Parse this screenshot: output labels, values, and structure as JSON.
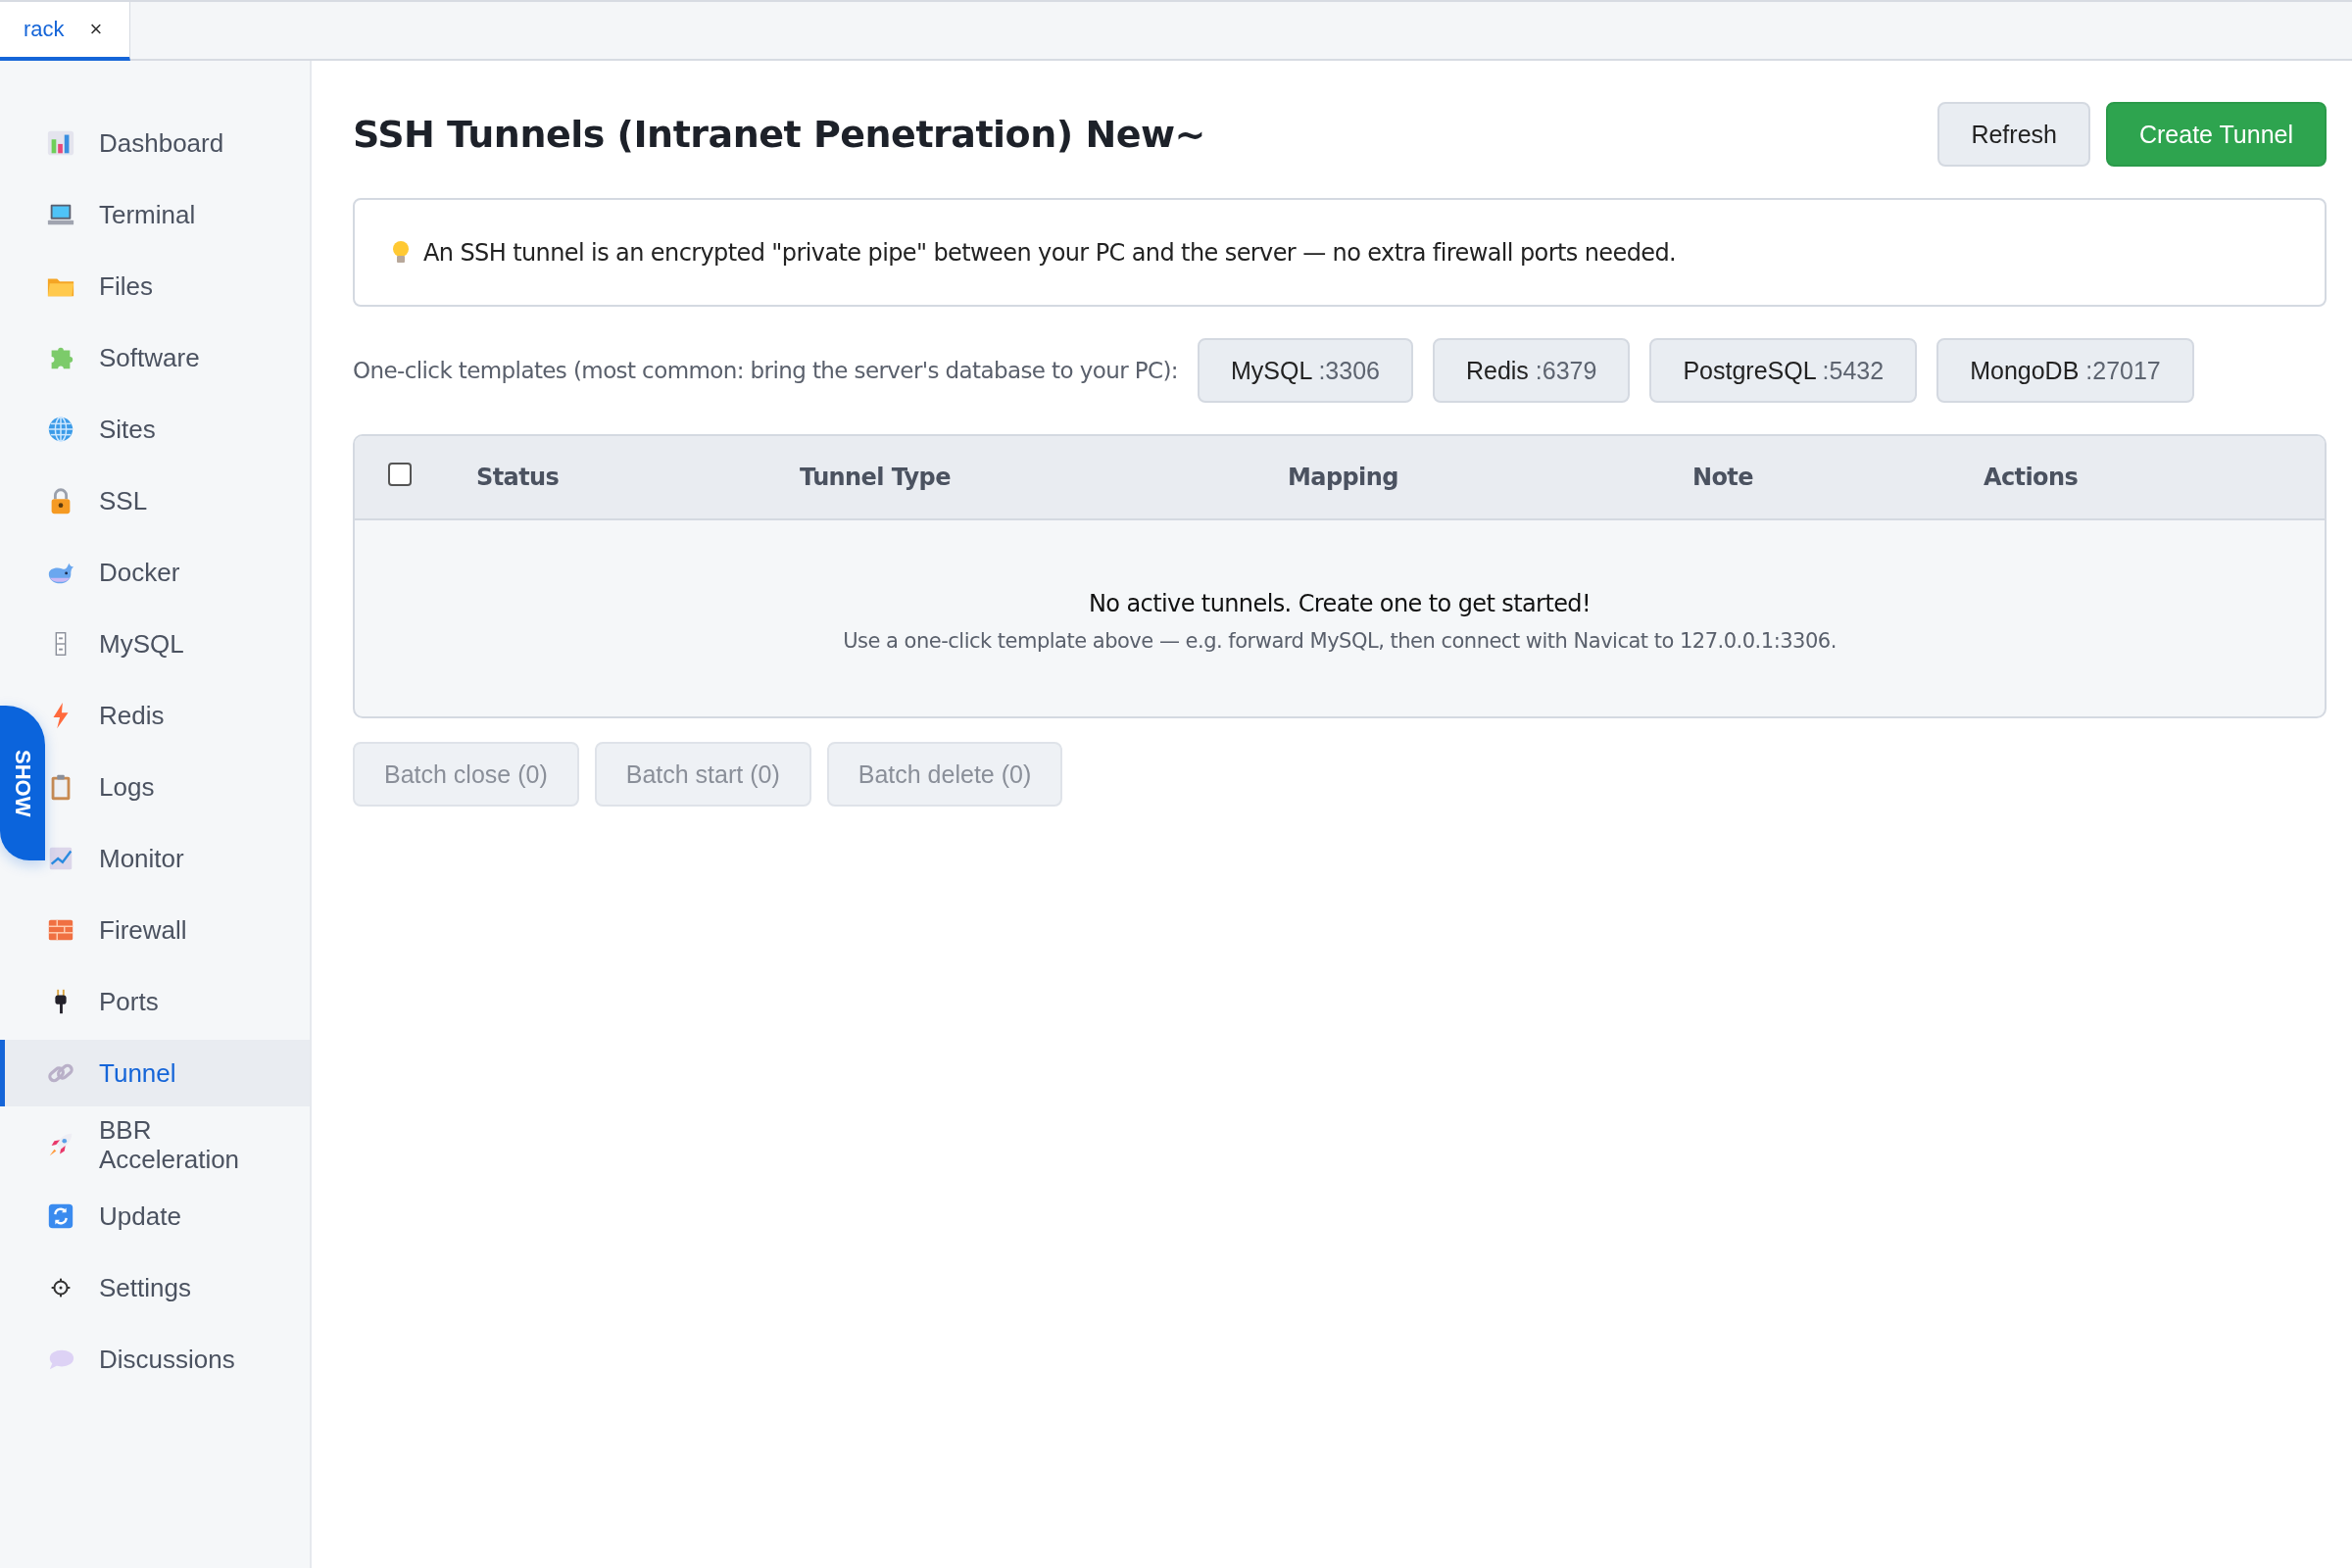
{
  "tabs": [
    {
      "label": "rack",
      "close": "×",
      "selected": true
    }
  ],
  "sidebar": {
    "items": [
      {
        "label": "Dashboard",
        "selected": false
      },
      {
        "label": "Terminal",
        "selected": false
      },
      {
        "label": "Files",
        "selected": false
      },
      {
        "label": "Software",
        "selected": false
      },
      {
        "label": "Sites",
        "selected": false
      },
      {
        "label": "SSL",
        "selected": false
      },
      {
        "label": "Docker",
        "selected": false
      },
      {
        "label": "MySQL",
        "selected": false
      },
      {
        "label": "Redis",
        "selected": false
      },
      {
        "label": "Logs",
        "selected": false
      },
      {
        "label": "Monitor",
        "selected": false
      },
      {
        "label": "Firewall",
        "selected": false
      },
      {
        "label": "Ports",
        "selected": false
      },
      {
        "label": "Tunnel",
        "selected": true
      },
      {
        "label": "BBR Acceleration",
        "selected": false
      },
      {
        "label": "Update",
        "selected": false
      },
      {
        "label": "Settings",
        "selected": false
      },
      {
        "label": "Discussions",
        "selected": false
      }
    ]
  },
  "show_tab": "SHOW",
  "page": {
    "title": "SSH Tunnels (Intranet Penetration) New~",
    "buttons": [
      {
        "label": "Refresh",
        "kind": "secondary"
      },
      {
        "label": "Create Tunnel",
        "kind": "primary"
      }
    ],
    "tip": "An SSH tunnel is an encrypted \"private pipe\" between your PC and the server — no extra firewall ports needed.",
    "templates_label": "One-click templates (most common: bring the server's database to your PC):",
    "templates": [
      {
        "name": "MySQL",
        "port": ":3306"
      },
      {
        "name": "Redis",
        "port": ":6379"
      },
      {
        "name": "PostgreSQL",
        "port": ":5432"
      },
      {
        "name": "MongoDB",
        "port": ":27017"
      }
    ],
    "table": {
      "select_all": {
        "checked": false
      },
      "columns": [
        "Status",
        "Tunnel Type",
        "Mapping",
        "Note",
        "Actions"
      ],
      "empty_title": "No active tunnels. Create one to get started!",
      "empty_hint": "Use a one-click template above — e.g. forward MySQL, then connect with Navicat to 127.0.0.1:3306."
    },
    "batch_buttons": [
      {
        "label": "Batch close (0)",
        "disabled": true
      },
      {
        "label": "Batch start (0)",
        "disabled": true
      },
      {
        "label": "Batch delete (0)",
        "disabled": true
      }
    ]
  }
}
